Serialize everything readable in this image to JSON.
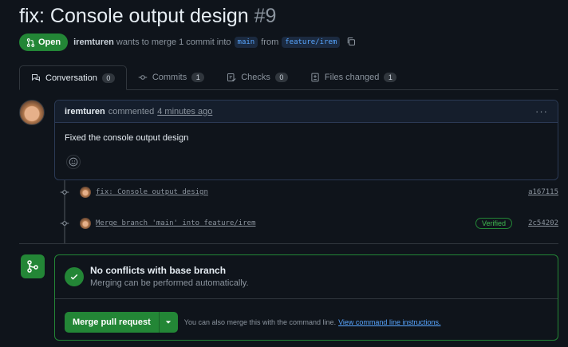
{
  "pr": {
    "title": "fix: Console output design",
    "number": "#9",
    "state": "Open",
    "author": "iremturen",
    "merge_text": "wants to merge 1 commit into",
    "base_branch": "main",
    "from_text": "from",
    "head_branch": "feature/irem"
  },
  "tabs": [
    {
      "label": "Conversation",
      "count": "0",
      "icon": "comment-discussion-icon"
    },
    {
      "label": "Commits",
      "count": "1",
      "icon": "git-commit-icon"
    },
    {
      "label": "Checks",
      "count": "0",
      "icon": "checklist-icon"
    },
    {
      "label": "Files changed",
      "count": "1",
      "icon": "file-diff-icon"
    }
  ],
  "comment": {
    "author": "iremturen",
    "action": "commented",
    "time": "4 minutes ago",
    "menu": "···",
    "body": "Fixed the console output design"
  },
  "commits": [
    {
      "message": "fix: Console output design",
      "sha": "a167115"
    },
    {
      "message": "Merge branch 'main' into feature/irem",
      "badge": "Verified",
      "sha": "2c54202"
    }
  ],
  "merge": {
    "status_title": "No conflicts with base branch",
    "status_sub": "Merging can be performed automatically.",
    "button": "Merge pull request",
    "hint": "You can also merge this with the command line.",
    "link": "View command line instructions."
  },
  "colors": {
    "background": "#0f141b",
    "accent_green": "#238636",
    "link_blue": "#58a6ff"
  }
}
